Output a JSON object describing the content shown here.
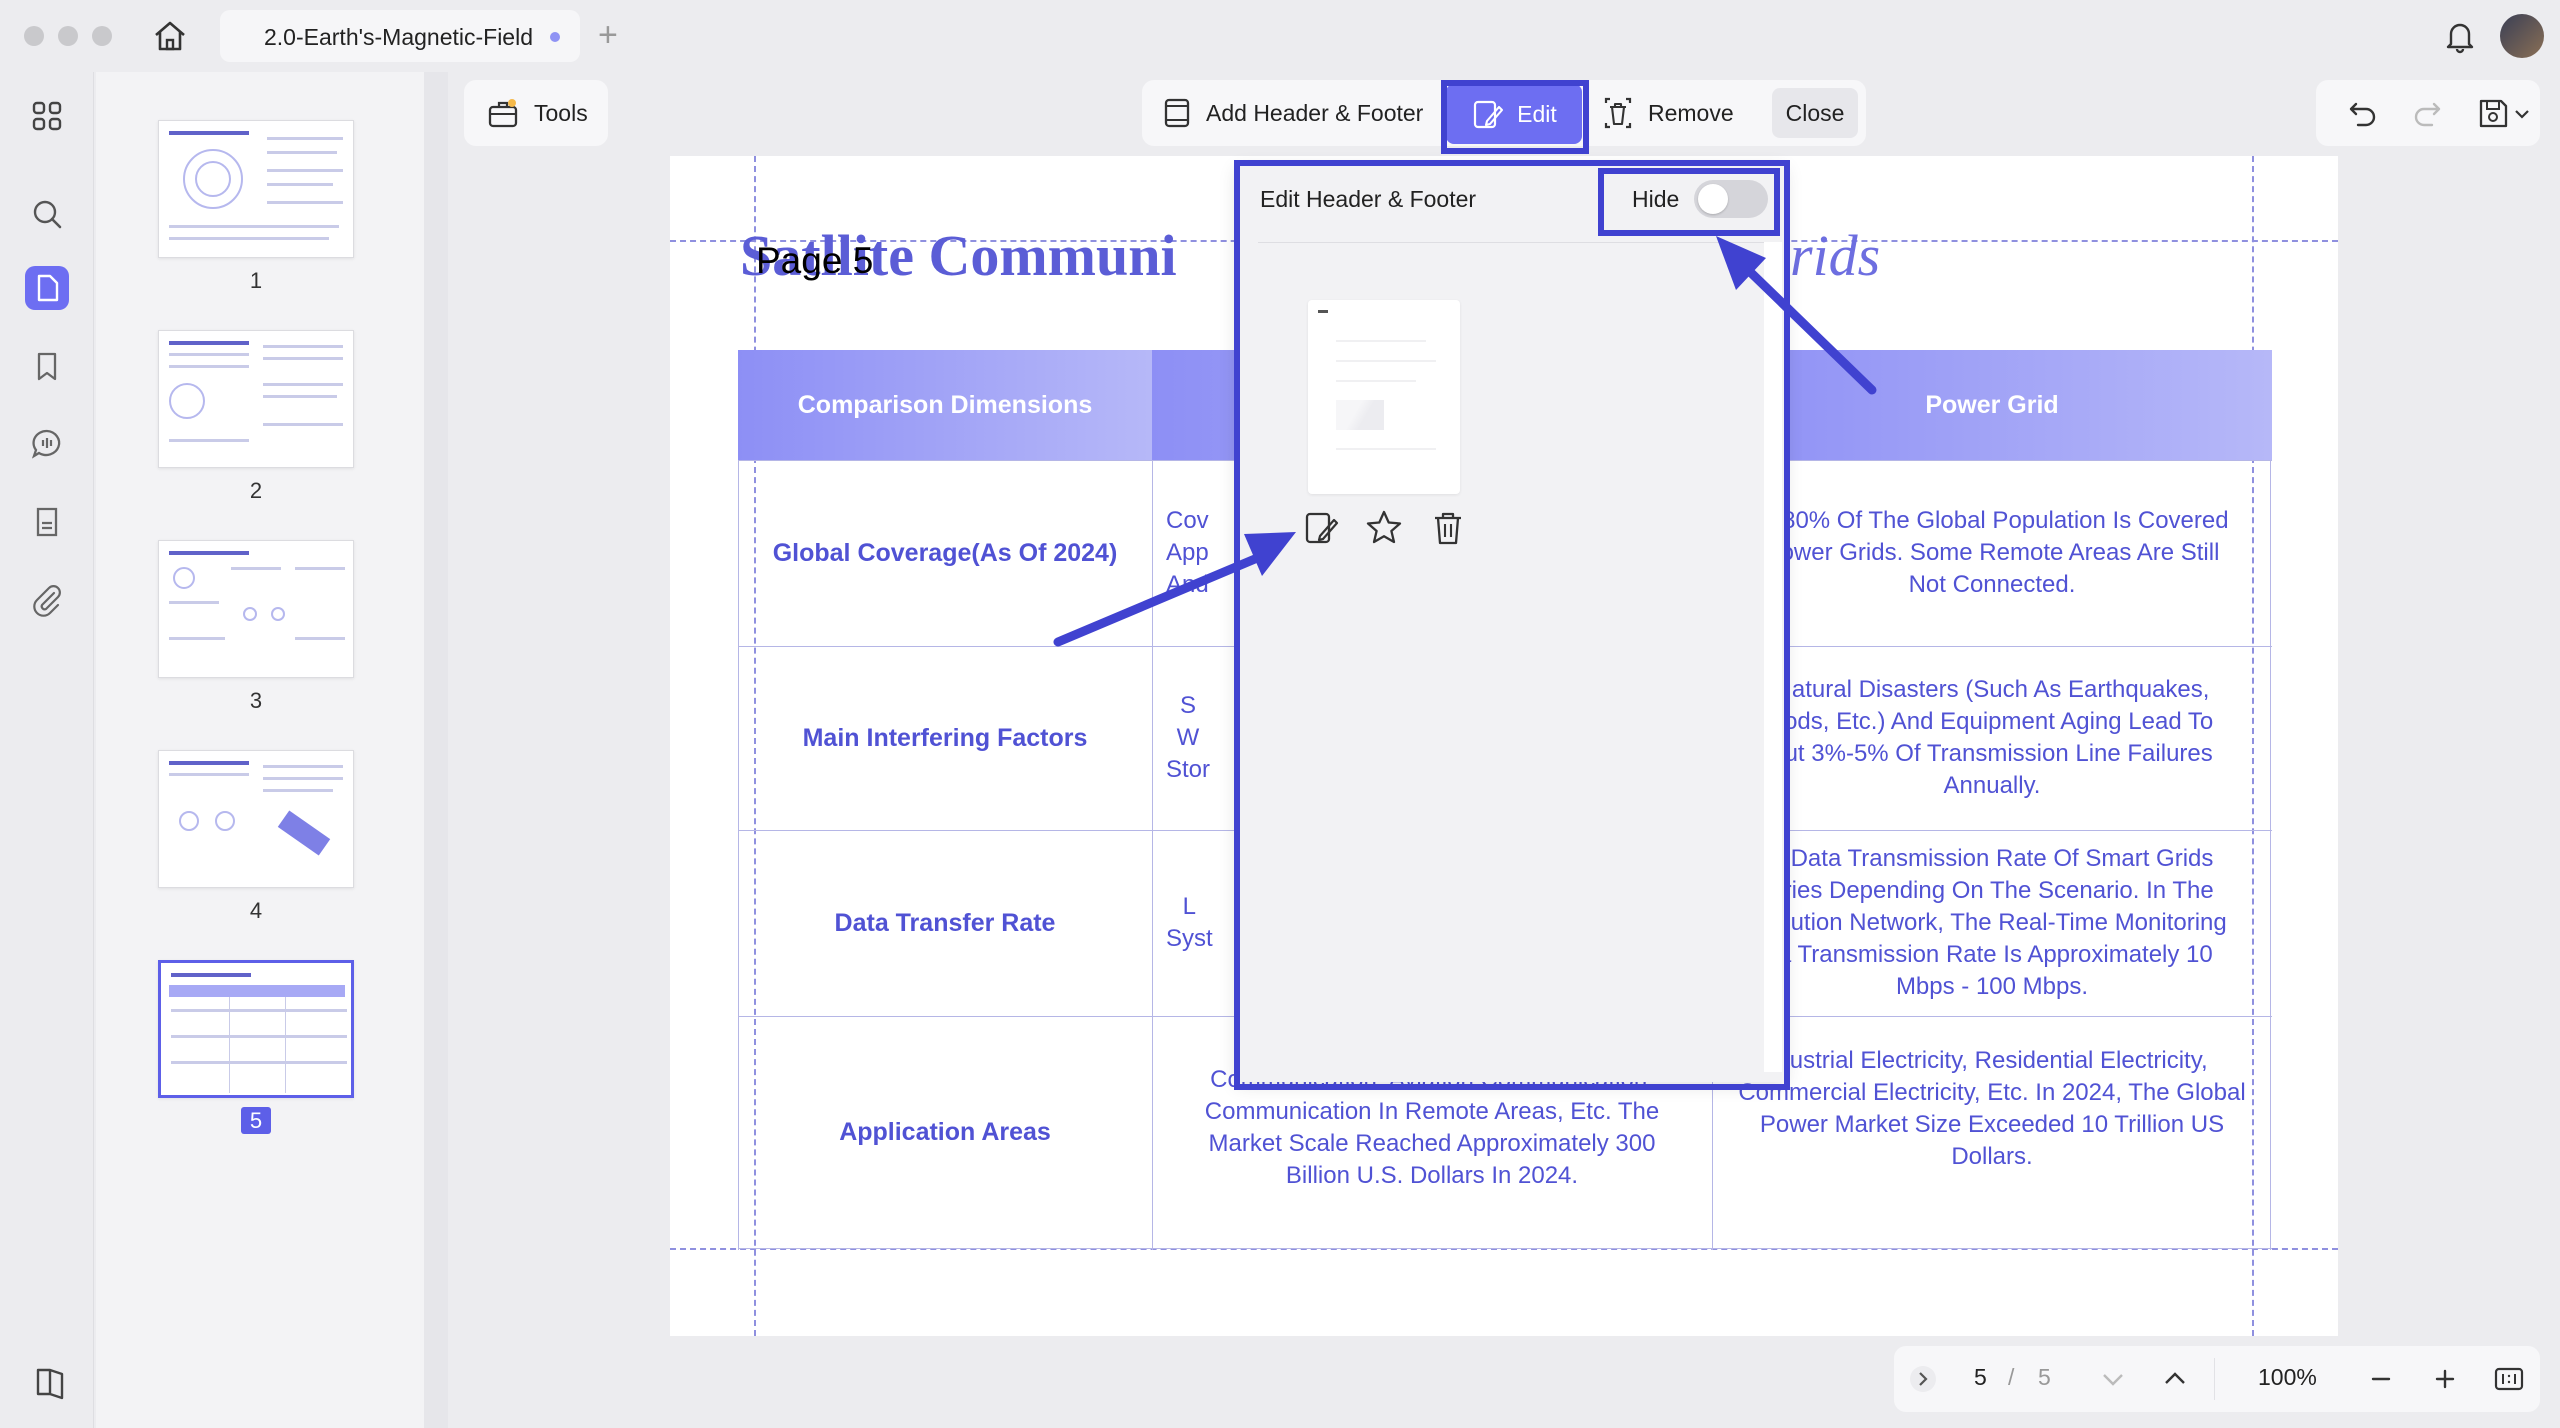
{
  "window": {
    "tab_title": "2.0-Earth's-Magnetic-Field",
    "tab_add": "+"
  },
  "icons": {
    "home": "home-icon",
    "bell": "bell-icon",
    "apps": "grid-icon",
    "search": "search-icon",
    "pages": "page-icon",
    "bookmark": "bookmark-icon",
    "comment": "comment-icon",
    "form": "form-icon",
    "attachment": "paperclip-icon"
  },
  "toolbar": {
    "tools_label": "Tools",
    "add_header_footer_label": "Add Header & Footer",
    "edit_label": "Edit",
    "remove_label": "Remove",
    "close_label": "Close"
  },
  "thumbnails": [
    {
      "number": "1"
    },
    {
      "number": "2"
    },
    {
      "number": "3"
    },
    {
      "number": "4"
    },
    {
      "number": "5",
      "active": true
    }
  ],
  "document": {
    "title_visible": "Sat",
    "title_mid": "llite Communi",
    "title_end": "rids",
    "header_text": "Page 5",
    "table": {
      "headers": [
        "Comparison Dimensions",
        "",
        "Power Grid"
      ],
      "rows": [
        {
          "label": "Global Coverage(As Of 2024)",
          "mid": "Cov\nApp\nAnd",
          "grid": "ut 80% Of The Global Population Is Covered\nPower Grids. Some Remote Areas Are Still\nNot Connected."
        },
        {
          "label": "Main Interfering Factors",
          "mid": "S\nW\nStor",
          "grid": "Natural Disasters (Such As Earthquakes,\noods, Etc.) And Equipment Aging Lead To\nout 3%-5% Of Transmission Line Failures\nAnnually."
        },
        {
          "label": "Data Transfer Rate",
          "mid": "L\nSyst",
          "grid": "e Data Transmission Rate Of Smart Grids\naries Depending On The Scenario. In The\ntribution Network, The Real-Time Monitoring\nta Transmission Rate Is Approximately 10\nMbps - 100 Mbps."
        },
        {
          "label": "Application Areas",
          "mid": "Communication, Aviation Communication,\nCommunication In Remote Areas, Etc. The\nMarket Scale Reached Approximately 300\nBillion U.S. Dollars In 2024.",
          "grid": "dustrial Electricity, Residential Electricity,\nCommercial Electricity, Etc. In 2024, The Global\nPower Market Size Exceeded 10 Trillion US\nDollars."
        }
      ]
    }
  },
  "popup": {
    "title": "Edit Header & Footer",
    "hide_label": "Hide",
    "hide_on": false
  },
  "bottom_nav": {
    "current_page": "5",
    "separator": "/",
    "total_pages": "5",
    "zoom": "100%"
  },
  "colors": {
    "accent": "#6d6ef2",
    "highlight": "#4042d0",
    "doc_text": "#5052d4"
  }
}
